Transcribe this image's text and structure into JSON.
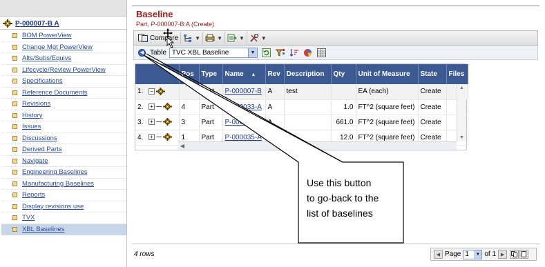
{
  "sidebar": {
    "part_number": "P-000007-B A",
    "items": [
      {
        "label": "BOM PowerView"
      },
      {
        "label": "Change Mgt PowerView"
      },
      {
        "label": "Alts/Subs/Equivs"
      },
      {
        "label": "Lifecycle/Review PowerView"
      },
      {
        "label": "Specifications"
      },
      {
        "label": "Reference Documents"
      },
      {
        "label": "Revisions"
      },
      {
        "label": "History"
      },
      {
        "label": "Issues"
      },
      {
        "label": "Discussions"
      },
      {
        "label": "Derived Parts"
      },
      {
        "label": "Navigate"
      },
      {
        "label": "Engineering Baselines"
      },
      {
        "label": "Manufacturing Baselines"
      },
      {
        "label": "Reports"
      },
      {
        "label": "Display revisions use"
      },
      {
        "label": "TVX"
      },
      {
        "label": "XBL Baselines"
      }
    ],
    "selected_index": 17
  },
  "page": {
    "title": "Baseline",
    "subtitle": "Part, P-000007-B:A (Create)"
  },
  "toolbar": {
    "compare_label": "Compare"
  },
  "tablebar": {
    "table_label": "Table",
    "table_selected": "TVC XBL Baseline"
  },
  "grid": {
    "columns": [
      "Pos",
      "Type",
      "Name",
      "Rev",
      "Description",
      "Qty",
      "Unit of Measure",
      "State",
      "Files"
    ],
    "sort_indicator": "▲",
    "rows": [
      {
        "index": "1.",
        "pos": "",
        "type": "Part",
        "name": "P-000007-B",
        "rev": "A",
        "description": "test",
        "qty": "",
        "uom": "EA (each)",
        "state": "Create"
      },
      {
        "index": "2.",
        "pos": "4",
        "type": "Part",
        "name": "P-000033-A",
        "rev": "A",
        "description": "",
        "qty": "1.0",
        "uom": "FT^2 (square feet)",
        "state": "Create"
      },
      {
        "index": "3.",
        "pos": "3",
        "type": "Part",
        "name": "P-00003",
        "rev": "A",
        "description": "",
        "qty": "661.0",
        "uom": "FT^2 (square feet)",
        "state": "Create"
      },
      {
        "index": "4.",
        "pos": "1",
        "type": "Part",
        "name": "P-000035-A",
        "rev": "A",
        "description": "",
        "qty": "12.0",
        "uom": "FT^2 (square feet)",
        "state": "Create"
      }
    ]
  },
  "footer": {
    "row_count": "4 rows",
    "page_label": "Page",
    "page_value": "1",
    "of_label": "of 1"
  },
  "callout": {
    "lines": [
      "Use this button",
      "to go-back to the",
      "list of baselines"
    ]
  }
}
